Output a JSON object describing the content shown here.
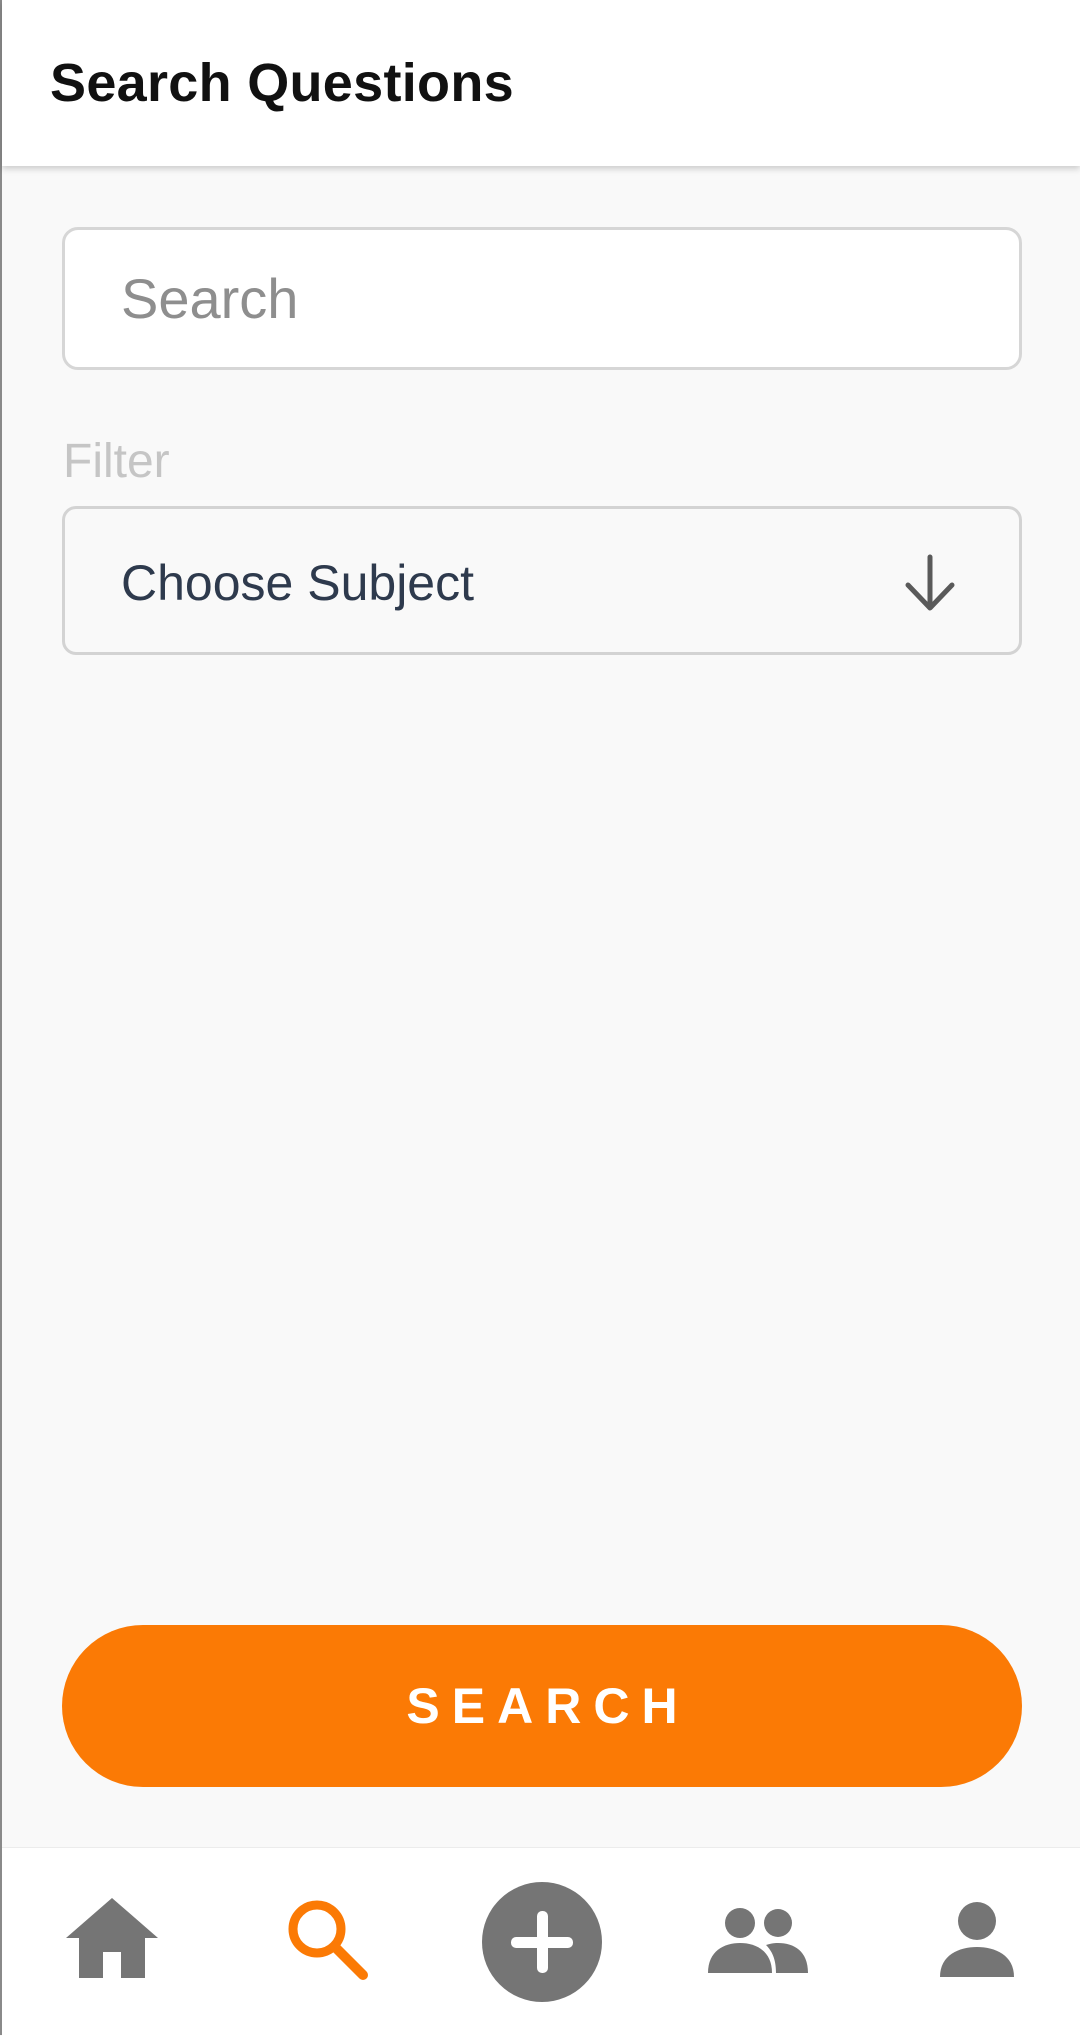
{
  "header": {
    "title": "Search Questions"
  },
  "search": {
    "placeholder": "Search",
    "value": ""
  },
  "filter": {
    "label": "Filter",
    "selected": "Choose Subject"
  },
  "actions": {
    "search_label": "SEARCH"
  },
  "bottom_nav": {
    "items": [
      {
        "id": "home",
        "icon": "home-icon",
        "active": false
      },
      {
        "id": "search",
        "icon": "search-icon",
        "active": true
      },
      {
        "id": "add",
        "icon": "add-circle-icon",
        "active": false
      },
      {
        "id": "people",
        "icon": "people-icon",
        "active": false
      },
      {
        "id": "profile",
        "icon": "person-icon",
        "active": false
      }
    ]
  },
  "colors": {
    "accent": "#fb7a05",
    "nav_icon": "#757575",
    "background": "#f9f9f9"
  }
}
